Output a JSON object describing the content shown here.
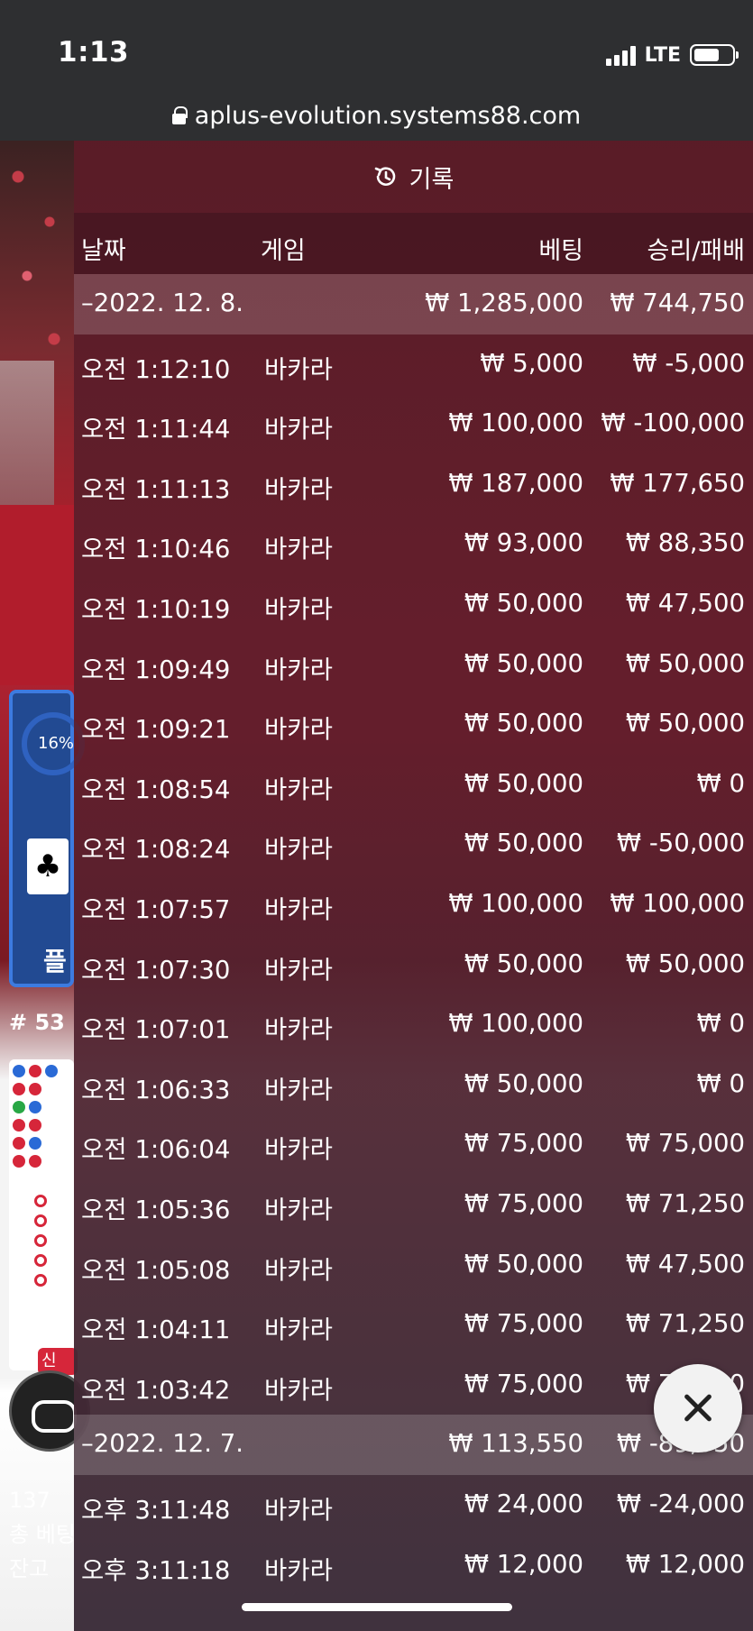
{
  "status_bar": {
    "time": "1:13",
    "network": "LTE"
  },
  "browser": {
    "url": "aplus-evolution.systems88.com"
  },
  "game": {
    "percent": "16%",
    "shoe_number": "# 53",
    "left_label": "플",
    "new_badge": "신",
    "bottom_lines": [
      "137",
      "총 베팅",
      "잔고"
    ]
  },
  "history": {
    "title": "기록",
    "columns": {
      "date": "날짜",
      "game": "게임",
      "bet": "베팅",
      "result": "승리/패배"
    },
    "rows": [
      {
        "type": "group",
        "date": "–2022. 12. 8.",
        "game": "",
        "bet": "₩ 1,285,000",
        "result": "₩ 744,750"
      },
      {
        "type": "item",
        "date": "오전 1:12:10",
        "game": "바카라",
        "bet": "₩ 5,000",
        "result": "₩ -5,000"
      },
      {
        "type": "item",
        "date": "오전 1:11:44",
        "game": "바카라",
        "bet": "₩ 100,000",
        "result": "₩ -100,000"
      },
      {
        "type": "item",
        "date": "오전 1:11:13",
        "game": "바카라",
        "bet": "₩ 187,000",
        "result": "₩ 177,650"
      },
      {
        "type": "item",
        "date": "오전 1:10:46",
        "game": "바카라",
        "bet": "₩ 93,000",
        "result": "₩ 88,350"
      },
      {
        "type": "item",
        "date": "오전 1:10:19",
        "game": "바카라",
        "bet": "₩ 50,000",
        "result": "₩ 47,500"
      },
      {
        "type": "item",
        "date": "오전 1:09:49",
        "game": "바카라",
        "bet": "₩ 50,000",
        "result": "₩ 50,000"
      },
      {
        "type": "item",
        "date": "오전 1:09:21",
        "game": "바카라",
        "bet": "₩ 50,000",
        "result": "₩ 50,000"
      },
      {
        "type": "item",
        "date": "오전 1:08:54",
        "game": "바카라",
        "bet": "₩ 50,000",
        "result": "₩ 0"
      },
      {
        "type": "item",
        "date": "오전 1:08:24",
        "game": "바카라",
        "bet": "₩ 50,000",
        "result": "₩ -50,000"
      },
      {
        "type": "item",
        "date": "오전 1:07:57",
        "game": "바카라",
        "bet": "₩ 100,000",
        "result": "₩ 100,000"
      },
      {
        "type": "item",
        "date": "오전 1:07:30",
        "game": "바카라",
        "bet": "₩ 50,000",
        "result": "₩ 50,000"
      },
      {
        "type": "item",
        "date": "오전 1:07:01",
        "game": "바카라",
        "bet": "₩ 100,000",
        "result": "₩ 0"
      },
      {
        "type": "item",
        "date": "오전 1:06:33",
        "game": "바카라",
        "bet": "₩ 50,000",
        "result": "₩ 0"
      },
      {
        "type": "item",
        "date": "오전 1:06:04",
        "game": "바카라",
        "bet": "₩ 75,000",
        "result": "₩ 75,000"
      },
      {
        "type": "item",
        "date": "오전 1:05:36",
        "game": "바카라",
        "bet": "₩ 75,000",
        "result": "₩ 71,250"
      },
      {
        "type": "item",
        "date": "오전 1:05:08",
        "game": "바카라",
        "bet": "₩ 50,000",
        "result": "₩ 47,500"
      },
      {
        "type": "item",
        "date": "오전 1:04:11",
        "game": "바카라",
        "bet": "₩ 75,000",
        "result": "₩ 71,250"
      },
      {
        "type": "item",
        "date": "오전 1:03:42",
        "game": "바카라",
        "bet": "₩ 75,000",
        "result": "₩ 71,250"
      },
      {
        "type": "group",
        "date": "–2022. 12. 7.",
        "game": "",
        "bet": "₩ 113,550",
        "result": "₩ -89,550"
      },
      {
        "type": "item",
        "date": "오후 3:11:48",
        "game": "바카라",
        "bet": "₩ 24,000",
        "result": "₩ -24,000"
      },
      {
        "type": "item",
        "date": "오후 3:11:18",
        "game": "바카라",
        "bet": "₩ 12,000",
        "result": "₩ 12,000"
      }
    ]
  }
}
